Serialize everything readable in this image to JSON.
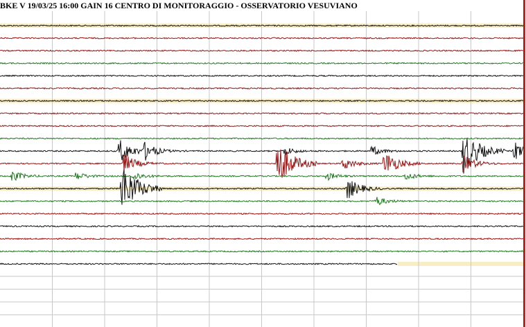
{
  "header": {
    "title": "BKE V 19/03/25 16:00 GAIN  16  CENTRO DI MONITORAGGIO - OSSERVATORIO VESUVIANO"
  },
  "colors": {
    "black": "#111111",
    "red": "#9a1515",
    "green": "#1f7a1f",
    "highlight": "#f8edc4",
    "grid": "#c8c8c8",
    "border": "#cc1a1a"
  },
  "chart_data": {
    "type": "line",
    "title": "BKE V 19/03/25 16:00 GAIN  16  CENTRO DI MONITORAGGIO - OSSERVATORIO VESUVIANO",
    "xlabel": "",
    "ylabel": "",
    "grid": true,
    "vertical_divisions": 10,
    "trace_colors": [
      "black",
      "red",
      "red",
      "green",
      "black",
      "red",
      "black",
      "red",
      "red",
      "green",
      "black",
      "red",
      "green",
      "black",
      "green",
      "red",
      "black",
      "red",
      "green",
      "black"
    ],
    "highlighted_traces": [
      0,
      6,
      13,
      19
    ],
    "recorded_fraction_last_trace": 0.76,
    "events": [
      {
        "trace": 10,
        "x": 0.227,
        "amp": 1.6,
        "color": "black"
      },
      {
        "trace": 10,
        "x": 0.276,
        "amp": 1.0,
        "color": "black"
      },
      {
        "trace": 13,
        "x": 0.232,
        "amp": 3.2,
        "color": "black"
      },
      {
        "trace": 11,
        "x": 0.236,
        "amp": 1.2,
        "color": "red"
      },
      {
        "trace": 12,
        "x": 0.253,
        "amp": 0.6,
        "color": "green"
      },
      {
        "trace": 12,
        "x": 0.022,
        "amp": 0.7,
        "color": "green"
      },
      {
        "trace": 12,
        "x": 0.145,
        "amp": 0.5,
        "color": "green"
      },
      {
        "trace": 11,
        "x": 0.527,
        "amp": 3.0,
        "color": "red"
      },
      {
        "trace": 10,
        "x": 0.543,
        "amp": 0.5,
        "color": "black"
      },
      {
        "trace": 11,
        "x": 0.655,
        "amp": 0.8,
        "color": "red"
      },
      {
        "trace": 13,
        "x": 0.663,
        "amp": 1.4,
        "color": "black"
      },
      {
        "trace": 11,
        "x": 0.734,
        "amp": 1.7,
        "color": "red"
      },
      {
        "trace": 10,
        "x": 0.71,
        "amp": 0.6,
        "color": "black"
      },
      {
        "trace": 10,
        "x": 0.885,
        "amp": 2.8,
        "color": "black"
      },
      {
        "trace": 10,
        "x": 0.982,
        "amp": 1.2,
        "color": "black"
      },
      {
        "trace": 11,
        "x": 0.885,
        "amp": 1.1,
        "color": "red"
      },
      {
        "trace": 14,
        "x": 0.718,
        "amp": 0.6,
        "color": "red"
      },
      {
        "trace": 12,
        "x": 0.624,
        "amp": 0.5,
        "color": "green"
      },
      {
        "trace": 12,
        "x": 0.775,
        "amp": 0.5,
        "color": "green"
      }
    ]
  }
}
